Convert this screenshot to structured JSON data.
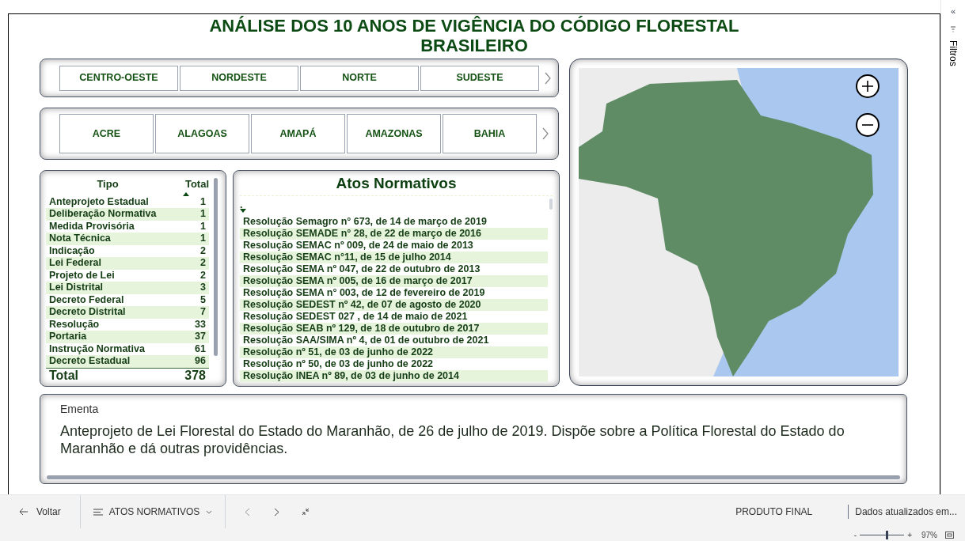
{
  "title": "ANÁLISE DOS 10 ANOS DE VIGÊNCIA DO CÓDIGO FLORESTAL BRASILEIRO",
  "regions": [
    {
      "label": "CENTRO-OESTE",
      "selected": false
    },
    {
      "label": "NORDESTE",
      "selected": false
    },
    {
      "label": "NORTE",
      "selected": false
    },
    {
      "label": "SUDESTE",
      "selected": false
    }
  ],
  "states": [
    {
      "label": "ACRE",
      "selected": false
    },
    {
      "label": "ALAGOAS",
      "selected": false
    },
    {
      "label": "AMAPÁ",
      "selected": false
    },
    {
      "label": "AMAZONAS",
      "selected": false
    },
    {
      "label": "BAHIA",
      "selected": false
    }
  ],
  "types_table": {
    "columns": [
      "Tipo",
      "Total"
    ],
    "rows": [
      [
        "Anteprojeto Estadual",
        "1"
      ],
      [
        "Deliberação Normativa",
        "1"
      ],
      [
        "Medida Provisória",
        "1"
      ],
      [
        "Nota Técnica",
        "1"
      ],
      [
        "Indicação",
        "2"
      ],
      [
        "Lei Federal",
        "2"
      ],
      [
        "Projeto de Lei",
        "2"
      ],
      [
        "Lei Distrital",
        "3"
      ],
      [
        "Decreto Federal",
        "5"
      ],
      [
        "Decreto Distrital",
        "7"
      ],
      [
        "Resolução",
        "33"
      ],
      [
        "Portaria",
        "37"
      ],
      [
        "Instrução Normativa",
        "61"
      ],
      [
        "Decreto Estadual",
        "96"
      ]
    ],
    "total": [
      "Total",
      "378"
    ]
  },
  "acts": {
    "title": "Atos Normativos",
    "column": ".",
    "rows": [
      "Resolução Semagro n° 673, de 14 de março de 2019",
      "Resolução SEMADE n° 28, de 22 de março de 2016",
      "Resolução SEMAC nº 009, de 24 de maio de 2013",
      "Resolução SEMAC n°11, de 15 de julho 2014",
      "Resolução SEMA nº 047, de 22 de outubro de 2013",
      "Resolução SEMA nº 005, de 16 de março de 2017",
      "Resolução SEMA n° 003, de 12 de fevereiro de 2019",
      "Resolução SEDEST nº 42, de 07 de agosto de 2020",
      "Resolução SEDEST 027 , de 14 de maio de 2021",
      "Resolução SEAB nº 129, de 18 de outubro de 2017",
      "Resolução SAA/SIMA nº 4, de 01 de outubro de 2021",
      "Resolução nº 51, de 03 de junho de 2022",
      "Resolução nº 50, de 03 de junho de 2022",
      "Resolução INEA nº 89, de 03 de junho de 2014"
    ]
  },
  "ementa": {
    "label": "Ementa",
    "text": "Anteprojeto de Lei Florestal do Estado do Maranhão, de  26 de julho de 2019. Dispõe sobre a Política Florestal do Estado do Maranhão e dá outras providências."
  },
  "filters_pane": {
    "collapse": "«",
    "label": "Filtros"
  },
  "bottom_bar": {
    "back": "Voltar",
    "page": "ATOS NORMATIVOS",
    "product": "PRODUTO FINAL",
    "updated": "Dados atualizados em..."
  },
  "zoom": {
    "level": 0.62,
    "percent": "97%",
    "minus": "-",
    "plus": "+"
  }
}
